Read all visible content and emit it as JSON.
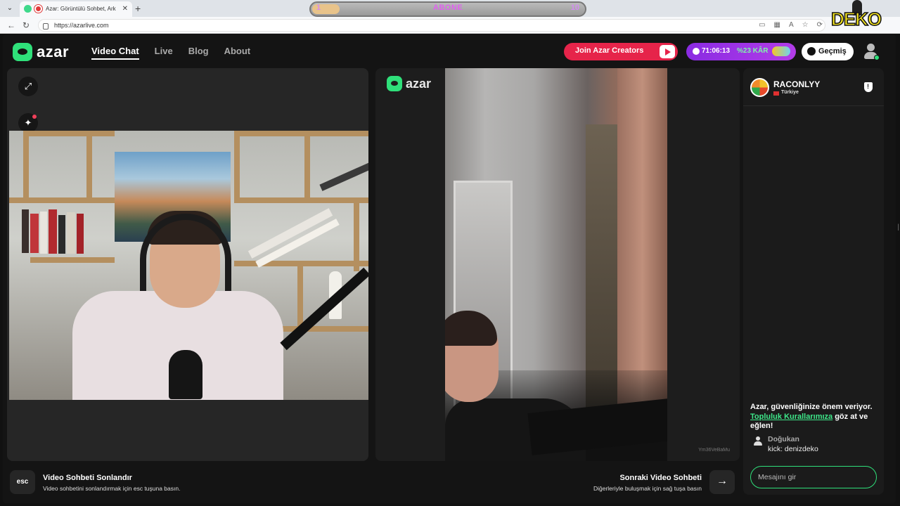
{
  "browser": {
    "menu_icon": "chevron-down-icon",
    "tab_title": "Azar: Görüntülü Sohbet, Arka",
    "tab_close": "✕",
    "new_tab": "+",
    "url": "https://azarlive.com",
    "nav_icons": [
      "back-icon",
      "reload-icon"
    ]
  },
  "overlay": {
    "abone_left": "1",
    "abone_label": "ABONE",
    "abone_right": "10",
    "abone_progress": 0.1,
    "deko_logo": "DEKO"
  },
  "header": {
    "logo_text": "azar",
    "nav": [
      {
        "label": "Video Chat",
        "active": true
      },
      {
        "label": "Live",
        "active": false
      },
      {
        "label": "Blog",
        "active": false
      },
      {
        "label": "About",
        "active": false
      }
    ],
    "creators_label": "Join Azar Creators",
    "promo_time": "71:06:13",
    "promo_discount": "%23 KÂR",
    "history_label": "Geçmiş"
  },
  "left_panel": {
    "buttons": [
      "expand-icon",
      "sparkle-effects-icon",
      "sticker-icon"
    ]
  },
  "stage": {
    "logo_text": "azar",
    "watermark": "Ym36VeBaMu"
  },
  "chat": {
    "partner_name": "RACONLYY",
    "partner_country": "Türkiye",
    "safety_prefix": "Azar, güvenliğinize önem veriyor. ",
    "safety_link": "Topluluk Kurallarımıza",
    "safety_suffix": " göz at ve eğlen!",
    "message_user": "Doğukan",
    "message_text": "kick: denizdeko",
    "input_placeholder": "Mesajını gir"
  },
  "footer": {
    "esc_key": "esc",
    "end_title": "Video Sohbeti Sonlandır",
    "end_sub": "Video sohbetini sonlandırmak için esc tuşuna basın.",
    "next_title": "Sonraki Video Sohbeti",
    "next_sub": "Diğerleriyle buluşmak için sağ tuşa basın",
    "next_key": "→"
  },
  "colors": {
    "brand_green": "#2fe07a",
    "creators_red": "#e6244a",
    "promo_purple": "#8a2be2"
  }
}
